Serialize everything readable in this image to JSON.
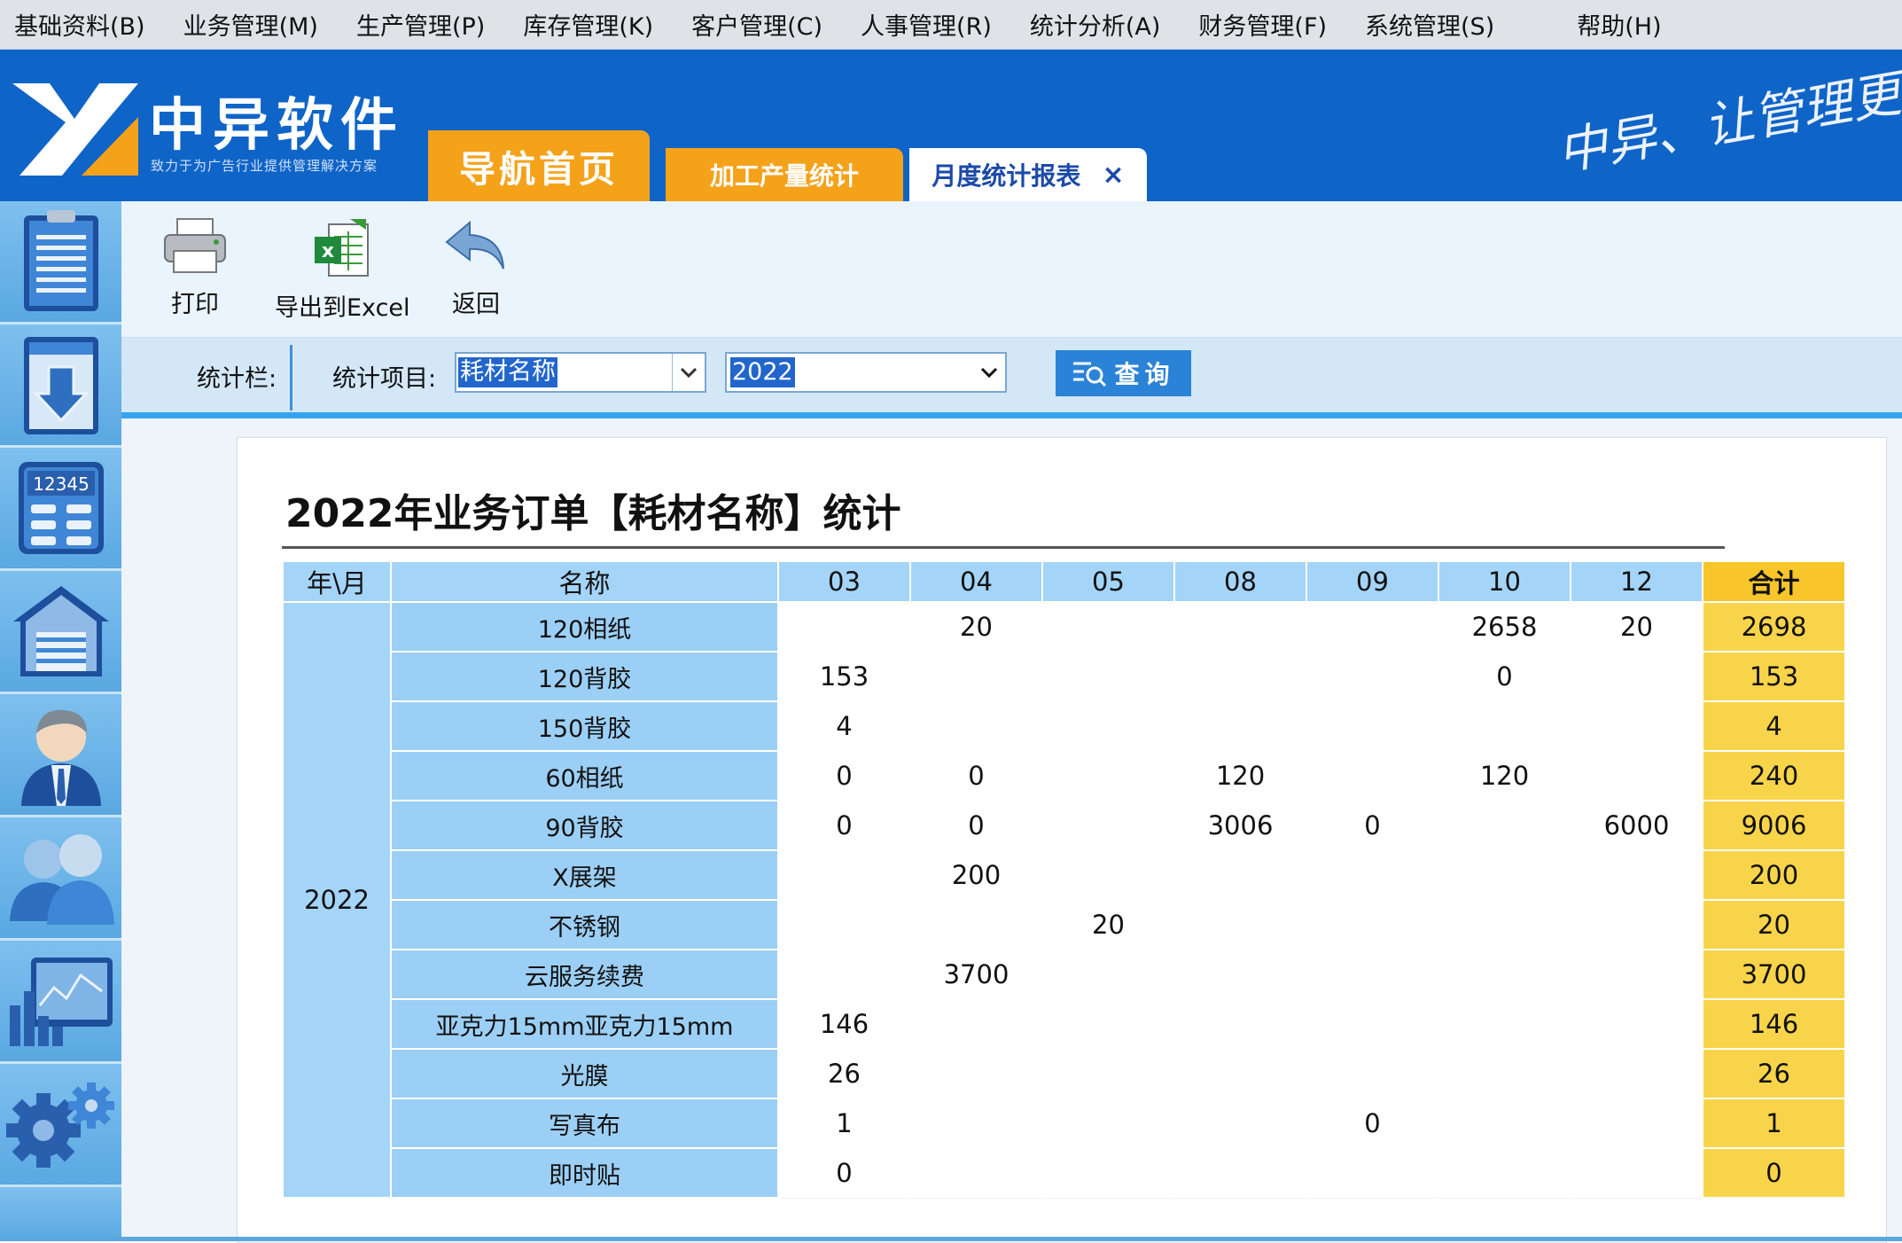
{
  "menu": [
    "基础资料(B)",
    "业务管理(M)",
    "生产管理(P)",
    "库存管理(K)",
    "客户管理(C)",
    "人事管理(R)",
    "统计分析(A)",
    "财务管理(F)",
    "系统管理(S)",
    "帮助(H)"
  ],
  "brand": {
    "name": "中异软件",
    "slogan": "致力于为广告行业提供管理解决方案",
    "signature": "中异、让管理更",
    "accent": "#f5a21b",
    "primary": "#0f64c8"
  },
  "tabs": {
    "home": "导航首页",
    "output": "加工产量统计",
    "monthly": "月度统计报表",
    "close": "×"
  },
  "sidebar_icons": [
    "document-icon",
    "download-icon",
    "calculator-icon",
    "warehouse-icon",
    "staff-icon",
    "customers-icon",
    "chart-icon",
    "settings-icon"
  ],
  "sidebar_calc_text": "12345",
  "toolbar": {
    "print": "打印",
    "export": "导出到Excel",
    "back": "返回"
  },
  "filter": {
    "stat_label": "统计栏:",
    "item_label": "统计项目:",
    "item_value": "耗材名称",
    "year_value": "2022",
    "query": "查询"
  },
  "report": {
    "title": "2022年业务订单【耗材名称】统计",
    "headers": {
      "yearmonth": "年\\月",
      "name": "名称",
      "months": [
        "03",
        "04",
        "05",
        "08",
        "09",
        "10",
        "12"
      ],
      "total": "合计"
    },
    "year": "2022",
    "rows": [
      {
        "name": "120相纸",
        "cells": [
          "",
          "20",
          "",
          "",
          "",
          "2658",
          "20"
        ],
        "total": "2698"
      },
      {
        "name": "120背胶",
        "cells": [
          "153",
          "",
          "",
          "",
          "",
          "0",
          ""
        ],
        "total": "153"
      },
      {
        "name": "150背胶",
        "cells": [
          "4",
          "",
          "",
          "",
          "",
          "",
          ""
        ],
        "total": "4"
      },
      {
        "name": "60相纸",
        "cells": [
          "0",
          "0",
          "",
          "120",
          "",
          "120",
          ""
        ],
        "total": "240"
      },
      {
        "name": "90背胶",
        "cells": [
          "0",
          "0",
          "",
          "3006",
          "0",
          "",
          "6000"
        ],
        "total": "9006"
      },
      {
        "name": "X展架",
        "cells": [
          "",
          "200",
          "",
          "",
          "",
          "",
          ""
        ],
        "total": "200"
      },
      {
        "name": "不锈钢",
        "cells": [
          "",
          "",
          "20",
          "",
          "",
          "",
          ""
        ],
        "total": "20"
      },
      {
        "name": "云服务续费",
        "cells": [
          "",
          "3700",
          "",
          "",
          "",
          "",
          ""
        ],
        "total": "3700"
      },
      {
        "name": "亚克力15mm亚克力15mm",
        "cells": [
          "146",
          "",
          "",
          "",
          "",
          "",
          ""
        ],
        "total": "146"
      },
      {
        "name": "光膜",
        "cells": [
          "26",
          "",
          "",
          "",
          "",
          "",
          ""
        ],
        "total": "26"
      },
      {
        "name": "写真布",
        "cells": [
          "1",
          "",
          "",
          "",
          "0",
          "",
          ""
        ],
        "total": "1"
      },
      {
        "name": "即时贴",
        "cells": [
          "0",
          "",
          "",
          "",
          "",
          "",
          ""
        ],
        "total": "0"
      }
    ]
  }
}
